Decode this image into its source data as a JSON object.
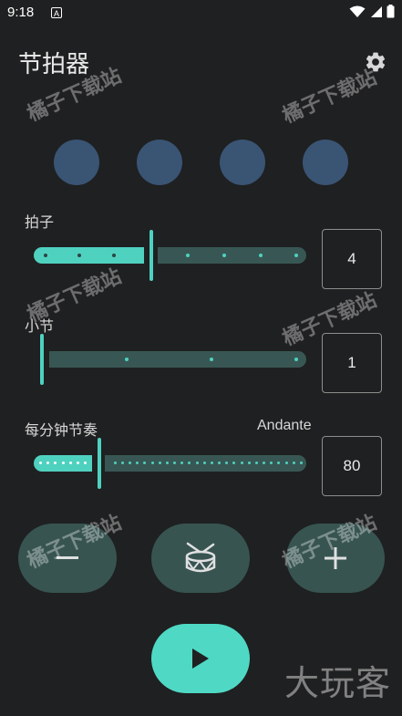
{
  "status_bar": {
    "time": "9:18",
    "notification_glyph": "A",
    "icons": [
      "wifi-icon",
      "signal-icon",
      "battery-icon"
    ]
  },
  "header": {
    "title": "节拍器",
    "settings_icon": "gear-icon"
  },
  "beat_indicators": {
    "count": 4,
    "color": "#3a5474"
  },
  "beats_slider": {
    "label": "拍子",
    "value": "4",
    "fill_fraction": 0.34
  },
  "measures_slider": {
    "label": "小节",
    "value": "1",
    "fill_fraction": 0.0
  },
  "tempo_slider": {
    "label": "每分钟节奏",
    "tempo_name": "Andante",
    "value": "80",
    "fill_fraction": 0.22
  },
  "controls": {
    "decrease_icon": "minus-icon",
    "drum_icon": "drum-icon",
    "increase_icon": "plus-icon",
    "play_icon": "play-icon"
  },
  "watermarks": {
    "text": "橘子下载站",
    "logo": "大玩客"
  },
  "colors": {
    "background": "#1f2021",
    "accent": "#4fd1c0",
    "track": "#385754",
    "button": "#375451",
    "play_button": "#4fd9c5"
  }
}
